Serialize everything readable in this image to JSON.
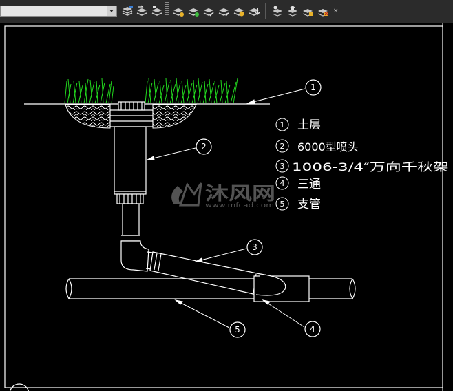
{
  "toolbar": {
    "layer_combo_value": "",
    "close_glyph": "×",
    "tools": [
      {
        "icon": "layer-states-icon"
      },
      {
        "icon": "layer-previous-icon"
      },
      {
        "icon": "layer-walk-icon"
      },
      {
        "icon": "match-layer-icon"
      },
      {
        "icon": "layer-isolate-icon"
      },
      {
        "icon": "layer-unisolate-icon"
      },
      {
        "icon": "layer-off-icon"
      },
      {
        "icon": "layer-freeze-icon"
      },
      {
        "icon": "layer-lock-icon"
      },
      {
        "icon": "layer-unlock-icon"
      },
      {
        "icon": "copy-objects-to-layer-icon"
      },
      {
        "icon": "layer-merge-icon"
      },
      {
        "icon": "layer-delete-icon"
      }
    ]
  },
  "drawing": {
    "callouts": [
      "1",
      "2",
      "3",
      "4",
      "5"
    ],
    "legend": [
      {
        "num": "1",
        "text": "土层"
      },
      {
        "num": "2",
        "text": "6000型喷头"
      },
      {
        "num": "3",
        "text": "1006-3/4″万向千秋架"
      },
      {
        "num": "4",
        "text": "三通"
      },
      {
        "num": "5",
        "text": "支管"
      }
    ],
    "watermark": {
      "brand": "沐风网",
      "url": "www.mfcad.com"
    },
    "colors": {
      "linework": "#ffffff",
      "grass": "#22d81e",
      "frame": "#ffffff",
      "background": "#000000"
    }
  }
}
